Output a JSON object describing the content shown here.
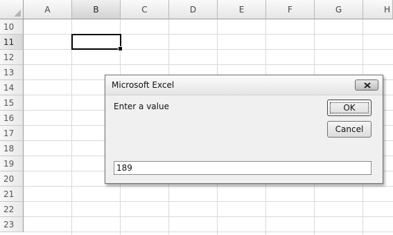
{
  "spreadsheet": {
    "columns": [
      "A",
      "B",
      "C",
      "D",
      "E",
      "F",
      "G",
      "H"
    ],
    "selected_column": "B",
    "rows": [
      "10",
      "11",
      "12",
      "13",
      "14",
      "15",
      "16",
      "17",
      "18",
      "19",
      "20",
      "21",
      "22",
      "23"
    ],
    "selected_row": "11",
    "active_cell": "B11"
  },
  "dialog": {
    "title": "Microsoft Excel",
    "prompt": "Enter a value",
    "ok_label": "OK",
    "cancel_label": "Cancel",
    "input_value": "189",
    "close_icon": "close-icon"
  }
}
